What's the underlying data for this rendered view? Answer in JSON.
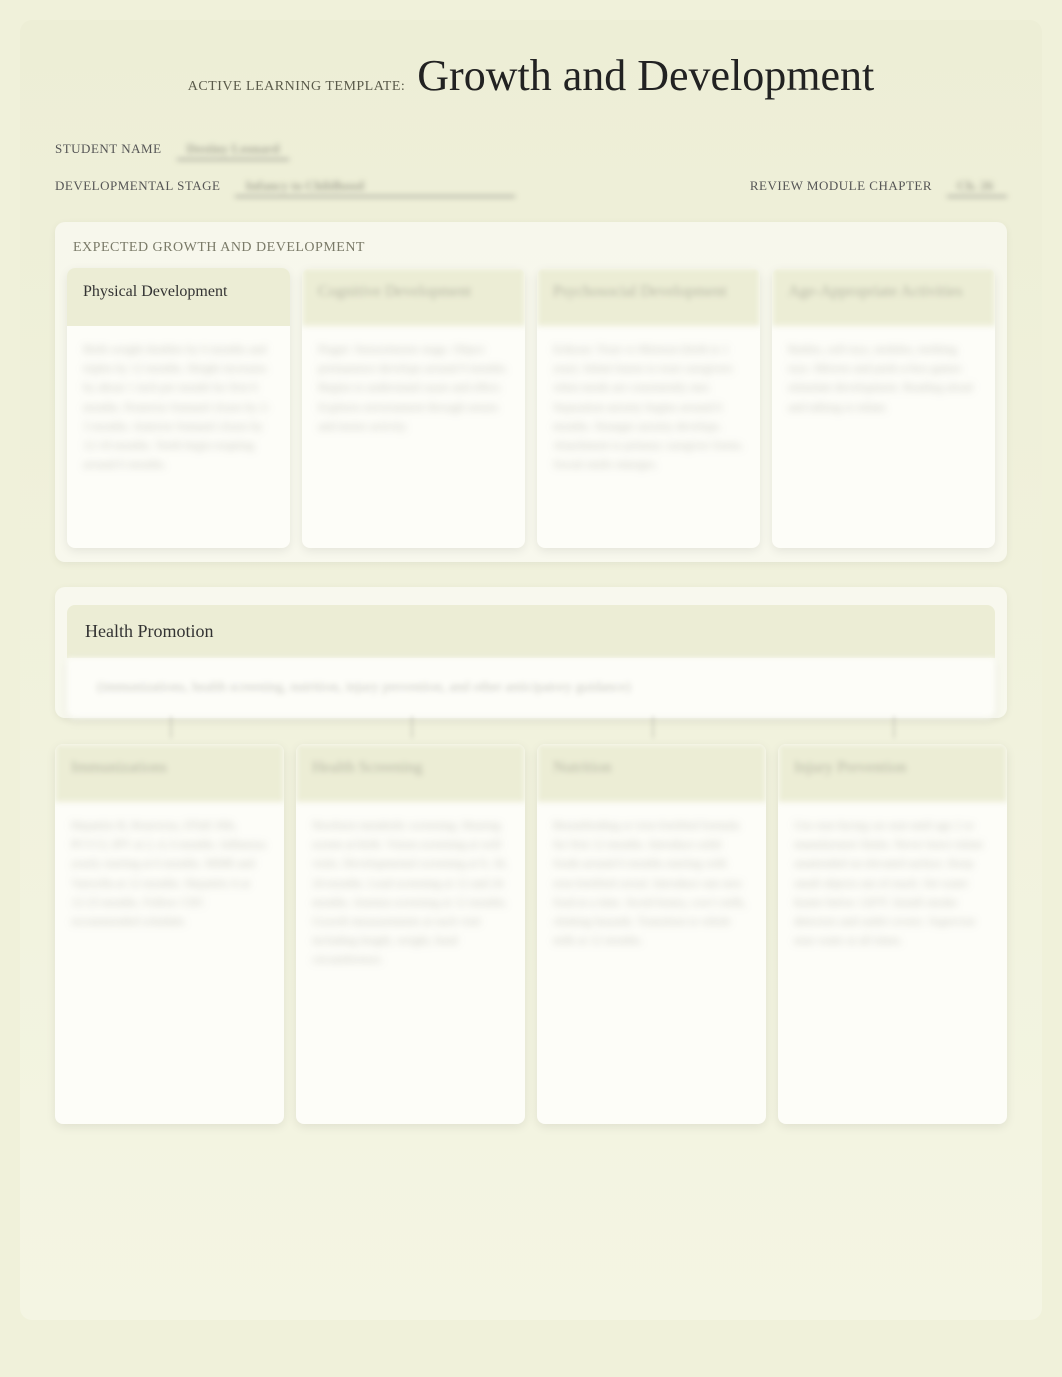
{
  "template_label": "ACTIVE LEARNING TEMPLATE:",
  "main_title": "Growth and Development",
  "fields": {
    "student_name_label": "STUDENT NAME",
    "student_name_value": "Destiny Leonard",
    "dev_stage_label": "DEVELOPMENTAL STAGE",
    "dev_stage_value": "Infancy to Childhood",
    "review_chapter_label": "REVIEW MODULE CHAPTER",
    "review_chapter_value": "Ch. 26"
  },
  "section1": {
    "heading": "EXPECTED GROWTH AND DEVELOPMENT",
    "cards": [
      {
        "title": "Physical Development",
        "blurred_title": false,
        "body": "Birth weight doubles by 6 months and triples by 12 months. Height increases by about 1 inch per month for first 6 months. Posterior fontanel closes by 2-3 months. Anterior fontanel closes by 12-18 months. Teeth begin erupting around 6 months."
      },
      {
        "title": "Cognitive Development",
        "blurred_title": true,
        "body": "Piaget: Sensorimotor stage. Object permanence develops around 9 months. Begins to understand cause and effect. Explores environment through senses and motor activity."
      },
      {
        "title": "Psychosocial Development",
        "blurred_title": true,
        "body": "Erikson: Trust vs Mistrust (birth to 1 year). Infant learns to trust caregivers when needs are consistently met. Separation anxiety begins around 6 months. Stranger anxiety develops. Attachment to primary caregiver forms. Social smile emerges."
      },
      {
        "title": "Age-Appropriate Activities",
        "blurred_title": true,
        "body": "Rattles, soft toys, mobiles, teething toys. Mirrors and peek-a-boo games stimulate development. Reading aloud and talking to infant."
      }
    ]
  },
  "section2": {
    "heading": "Health Promotion",
    "tagline": "(immunizations, health screening, nutrition, injury prevention, and other anticipatory guidance)",
    "cards": [
      {
        "title": "Immunizations",
        "blurred_title": true,
        "body": "Hepatitis B, Rotavirus, DTaP, Hib, PCV13, IPV at 2, 4, 6 months. Influenza yearly starting at 6 months. MMR and Varicella at 12 months. Hepatitis A at 12-23 months. Follow CDC recommended schedule."
      },
      {
        "title": "Health Screening",
        "blurred_title": true,
        "body": "Newborn metabolic screening. Hearing screen at birth. Vision screening at well visits. Developmental screening at 9, 18, 24 months. Lead screening at 12 and 24 months. Anemia screening at 12 months. Growth measurements at each visit including length, weight, head circumference."
      },
      {
        "title": "Nutrition",
        "blurred_title": true,
        "body": "Breastfeeding or iron-fortified formula for first 12 months. Introduce solid foods around 6 months starting with iron-fortified cereal. Introduce one new food at a time. Avoid honey, cow's milk, choking hazards. Transition to whole milk at 12 months."
      },
      {
        "title": "Injury Prevention",
        "blurred_title": true,
        "body": "Use rear-facing car seat until age 2 or manufacturer limits. Never leave infant unattended on elevated surface. Keep small objects out of reach. Set water heater below 120°F. Install smoke detectors and outlet covers. Supervise near water at all times."
      }
    ]
  }
}
